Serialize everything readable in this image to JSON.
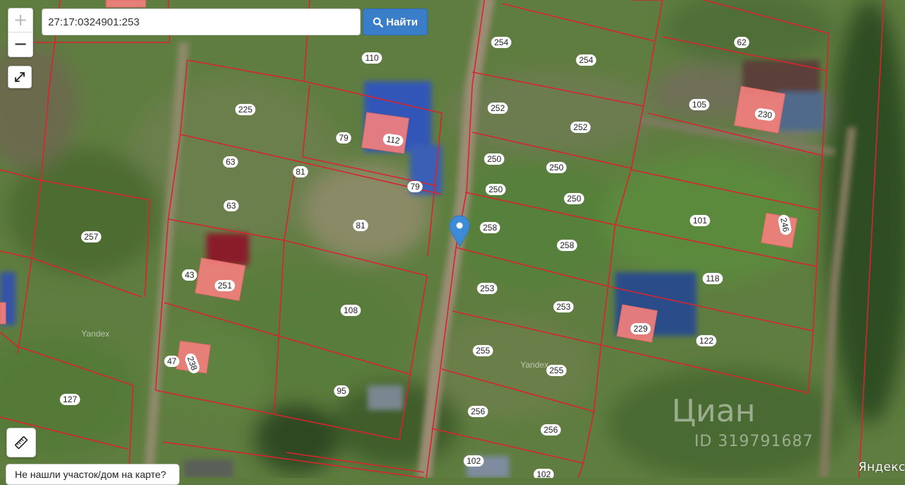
{
  "search": {
    "query": "27:17:0324901:253",
    "button_label": "Найти"
  },
  "controls": {
    "zoom_in": "+",
    "zoom_out": "−"
  },
  "not_found_label": "Не нашли участок/дом на карте?",
  "map_attribution": "Яндекс",
  "tile_watermark": "Yandex",
  "watermark": {
    "logo_text": "Циан",
    "listing_id": "ID 319791687"
  },
  "colors": {
    "boundary": "#d8242e",
    "building_fill": "#f27f7d",
    "search_button": "#3a7dc9",
    "marker": "#3d8bd6"
  },
  "parcel_labels": [
    "110",
    "254",
    "254",
    "62",
    "225",
    "79",
    "112",
    "252",
    "252",
    "105",
    "230",
    "63",
    "81",
    "250",
    "250",
    "63",
    "81",
    "79",
    "250",
    "250",
    "101",
    "246",
    "257",
    "258",
    "258",
    "118",
    "43",
    "251",
    "253",
    "253",
    "108",
    "229",
    "122",
    "47",
    "238",
    "255",
    "255",
    "95",
    "127",
    "256",
    "256",
    "102",
    "102"
  ]
}
